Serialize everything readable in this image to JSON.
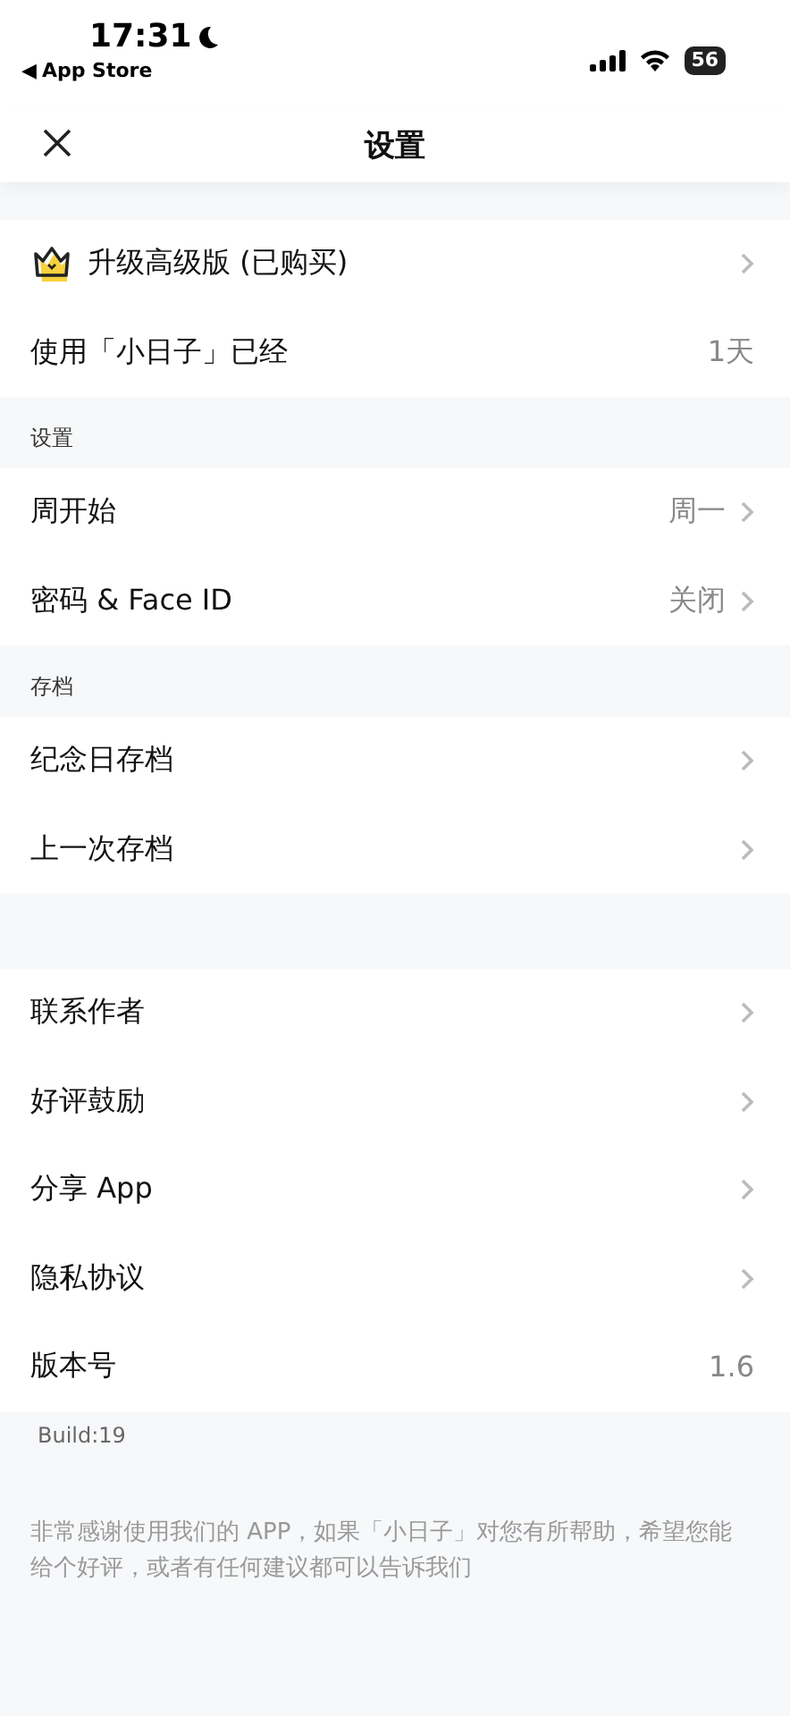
{
  "status_bar": {
    "time": "17:31",
    "back_arrow": "◀",
    "back_label": "App Store",
    "battery": "56"
  },
  "nav": {
    "title": "设置"
  },
  "sections": [
    {
      "items": [
        {
          "kind": "crown",
          "label": "升级高级版 (已购买)",
          "chevron": true
        },
        {
          "kind": "plain",
          "label": "使用「小日子」已经",
          "value": "1天",
          "chevron": false
        }
      ]
    },
    {
      "header": "设置",
      "items": [
        {
          "kind": "plain",
          "label": "周开始",
          "value": "周一",
          "chevron": true
        },
        {
          "kind": "plain",
          "label": "密码 & Face ID",
          "value": "关闭",
          "chevron": true
        }
      ]
    },
    {
      "header": "存档",
      "items": [
        {
          "kind": "plain",
          "label": "纪念日存档",
          "chevron": true
        },
        {
          "kind": "plain",
          "label": "上一次存档",
          "chevron": true
        }
      ]
    },
    {
      "items": [
        {
          "kind": "plain",
          "label": "联系作者",
          "chevron": true
        },
        {
          "kind": "plain",
          "label": "好评鼓励",
          "chevron": true
        },
        {
          "kind": "plain",
          "label": "分享 App",
          "chevron": true
        },
        {
          "kind": "plain",
          "label": "隐私协议",
          "chevron": true
        },
        {
          "kind": "plain",
          "label": "版本号",
          "value": "1.6",
          "chevron": false
        }
      ]
    }
  ],
  "build": "Build:19",
  "footer": "非常感谢使用我们的 APP，如果「小日子」对您有所帮助，希望您能给个好评，或者有任何建议都可以告诉我们"
}
